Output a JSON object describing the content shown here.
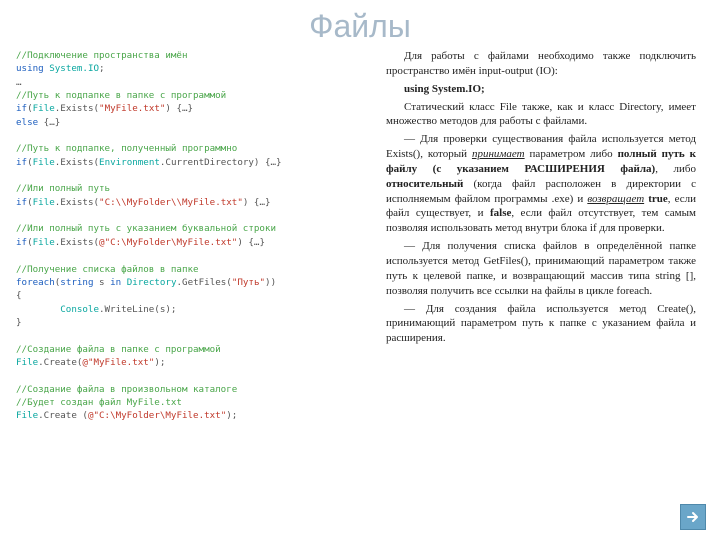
{
  "title": "Файлы",
  "code": {
    "c1": "//Подключение пространства имён",
    "l2a": "using",
    "l2b": "System.IO",
    "l2c": ";",
    "l3": "…",
    "c4": "//Путь к подпапке в папке с программой",
    "l5a": "if",
    "l5b": "File",
    "l5c": ".Exists(",
    "l5d": "\"MyFile.txt\"",
    "l5e": ") {…}",
    "l6a": "else",
    "l6b": " {…}",
    "c8": "//Путь к подпапке, полученный программно",
    "l9a": "if",
    "l9b": "File",
    "l9c": ".Exists(",
    "l9d": "Environment",
    "l9e": ".CurrentDirectory) {…}",
    "c11": "//Или полный путь",
    "l12a": "if",
    "l12b": "File",
    "l12c": ".Exists(",
    "l12d": "\"C:\\\\MyFolder\\\\MyFile.txt\"",
    "l12e": ") {…}",
    "c14": "//Или полный путь с указанием буквальной строки",
    "l15a": "if",
    "l15b": "File",
    "l15c": ".Exists(",
    "l15d": "@\"C:\\MyFolder\\MyFile.txt\"",
    "l15e": ") {…}",
    "c17": "//Получение списка файлов в папке",
    "l18a": "foreach",
    "l18b": "string",
    "l18c": " s ",
    "l18d": "in",
    "l18e": " Directory",
    "l18f": ".GetFiles(",
    "l18g": "\"Путь\"",
    "l18h": "))",
    "l19": "{",
    "l20a": "        Console",
    "l20b": ".WriteLine(s);",
    "l21": "}",
    "c23": "//Создание файла в папке с программой",
    "l24a": "File",
    "l24b": ".Create(",
    "l24c": "@\"MyFile.txt\"",
    "l24d": ");",
    "c26": "//Создание файла в произвольном каталоге",
    "c27": "//Будет создан файл MyFile.txt",
    "l28a": "File",
    "l28b": ".Create (",
    "l28c": "@\"C:\\MyFolder\\MyFile.txt\"",
    "l28d": ");"
  },
  "text": {
    "p1a": "Для работы с файлами необходимо также подключить пространство имён input-output (IO):",
    "p2": "using System.IO;",
    "p3": "Статический класс File также, как и класс Directory, имеет множество методов для работы с файлами.",
    "p4a": "— Для проверки существования файла используется метод Exists(), который ",
    "p4b": "принимает",
    "p4c": " параметром либо ",
    "p4d": "полный путь к файлу (с указанием РАСШИРЕНИЯ файла)",
    "p4e": ", либо ",
    "p4f": "относительный",
    "p4g": " (когда файл расположен в директории с исполняемым файлом программы .exe) и ",
    "p4h": "возвращает",
    "p4i": " true",
    "p4j": ", если файл существует, и ",
    "p4k": "false",
    "p4l": ", если файл отсутствует, тем самым позволяя использовать метод внутри блока if для проверки.",
    "p5": "— Для получения списка файлов в определённой папке используется метод GetFiles(), принимающий параметром также путь к целевой папке, и возвращающий массив типа string [], позволяя получить все ссылки на файлы в цикле foreach.",
    "p6": "— Для создания файла используется метод Create(), принимающий параметром путь к папке с указанием файла и расширения."
  },
  "nav": {
    "label": "next"
  }
}
